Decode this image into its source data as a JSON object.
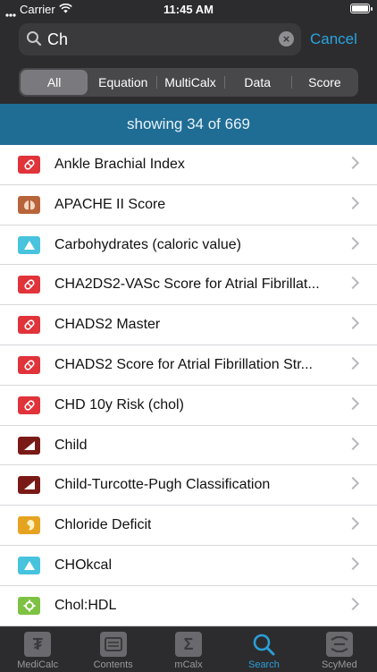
{
  "status": {
    "carrier": "Carrier",
    "time": "11:45 AM"
  },
  "search": {
    "value": "Ch",
    "placeholder": "Search",
    "cancel_label": "Cancel"
  },
  "segments": [
    {
      "label": "All",
      "selected": true
    },
    {
      "label": "Equation",
      "selected": false
    },
    {
      "label": "MultiCalx",
      "selected": false
    },
    {
      "label": "Data",
      "selected": false
    },
    {
      "label": "Score",
      "selected": false
    }
  ],
  "banner": {
    "text": "showing 34 of 669"
  },
  "rows": [
    {
      "label": "Ankle Brachial Index",
      "icon": "pill-icon",
      "color": "#e0333a"
    },
    {
      "label": "APACHE II Score",
      "icon": "lungs-icon",
      "color": "#b8643a"
    },
    {
      "label": "Carbohydrates (caloric value)",
      "icon": "triangle-icon",
      "color": "#48c3de"
    },
    {
      "label": "CHA2DS2-VASc Score for Atrial Fibrillat...",
      "icon": "pill-icon",
      "color": "#e0333a"
    },
    {
      "label": "CHADS2 Master",
      "icon": "pill-icon",
      "color": "#e0333a"
    },
    {
      "label": "CHADS2 Score for Atrial Fibrillation Str...",
      "icon": "pill-icon",
      "color": "#e0333a"
    },
    {
      "label": "CHD 10y Risk (chol)",
      "icon": "pill-icon",
      "color": "#e0333a"
    },
    {
      "label": "Child",
      "icon": "liver-icon",
      "color": "#7a1a16"
    },
    {
      "label": "Child-Turcotte-Pugh Classification",
      "icon": "liver-icon",
      "color": "#7a1a16"
    },
    {
      "label": "Chloride Deficit",
      "icon": "kidney-icon",
      "color": "#e6a321"
    },
    {
      "label": "CHOkcal",
      "icon": "triangle-icon",
      "color": "#48c3de"
    },
    {
      "label": "Chol:HDL",
      "icon": "gear-icon",
      "color": "#7dc242"
    }
  ],
  "tabs": [
    {
      "label": "MediCalc",
      "icon": "medicalc-icon",
      "active": false
    },
    {
      "label": "Contents",
      "icon": "contents-icon",
      "active": false
    },
    {
      "label": "mCalx",
      "icon": "sigma-icon",
      "active": false
    },
    {
      "label": "Search",
      "icon": "search-icon",
      "active": true
    },
    {
      "label": "ScyMed",
      "icon": "scymed-icon",
      "active": false
    }
  ]
}
